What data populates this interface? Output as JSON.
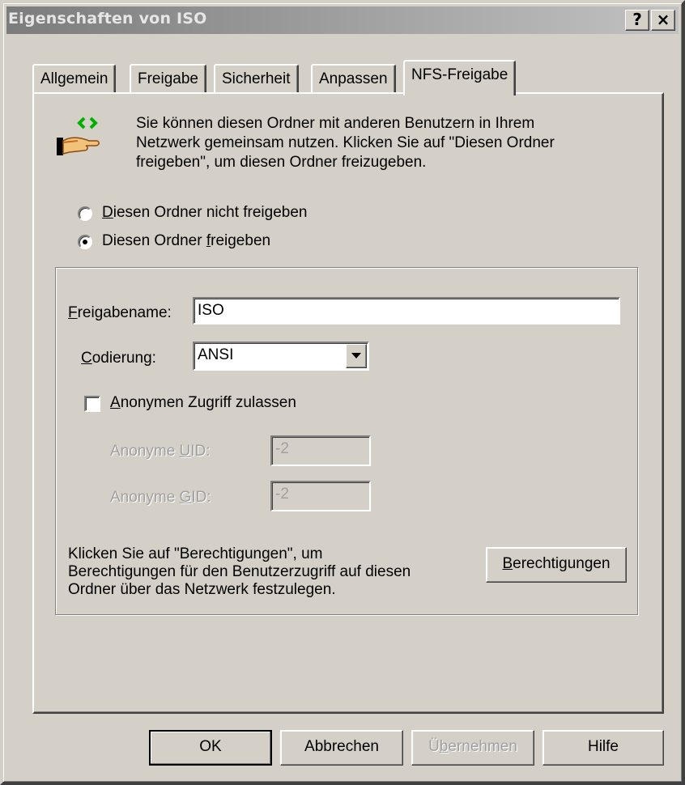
{
  "window": {
    "title": "Eigenschaften von ISO",
    "help_btn": "?",
    "close_btn": "×"
  },
  "tabs": [
    {
      "label": "Allgemein",
      "active": false
    },
    {
      "label": "Freigabe",
      "active": false
    },
    {
      "label": "Sicherheit",
      "active": false
    },
    {
      "label": "Anpassen",
      "active": false
    },
    {
      "label": "NFS-Freigabe",
      "active": true
    }
  ],
  "intro": {
    "line1": "Sie können diesen Ordner mit anderen Benutzern in Ihrem",
    "line2": "Netzwerk gemeinsam nutzen. Klicken Sie auf \"Diesen Ordner",
    "line3": "freigeben\", um diesen Ordner freizugeben.",
    "icon": "share-hand-icon"
  },
  "radios": {
    "no_share": {
      "pre": "",
      "accel": "D",
      "post": "iesen Ordner nicht freigeben",
      "checked": false
    },
    "share": {
      "pre": "Diesen Ordner ",
      "accel": "f",
      "post": "reigeben",
      "checked": true
    }
  },
  "share_name": {
    "accel": "F",
    "rest": "reigabename:",
    "value": "ISO"
  },
  "encoding": {
    "accel": "C",
    "rest": "odierung:",
    "value": "ANSI"
  },
  "anon_access": {
    "accel": "A",
    "rest": "nonymen Zugriff zulassen",
    "checked": false
  },
  "anon_uid": {
    "pre": "Anonyme ",
    "accel": "U",
    "post": "ID:",
    "value": "-2"
  },
  "anon_gid": {
    "pre": "Anonyme ",
    "accel": "G",
    "post": "ID:",
    "value": "-2"
  },
  "permissions": {
    "line1": "Klicken Sie auf \"Berechtigungen\", um",
    "line2": "Berechtigungen für den Benutzerzugriff auf diesen",
    "line3": "Ordner über das Netzwerk festzulegen.",
    "btn_accel": "B",
    "btn_rest": "erechtigungen"
  },
  "buttons": {
    "ok": "OK",
    "cancel": "Abbrechen",
    "apply_pre": "Ü",
    "apply_accel": "b",
    "apply_post": "ernehmen",
    "help": "Hilfe"
  },
  "colors": {
    "face": "#d4d0c8",
    "desktop": "#3a5fa8",
    "title_gradient_start": "#7c7c7c",
    "title_gradient_end": "#c2c2c2"
  }
}
